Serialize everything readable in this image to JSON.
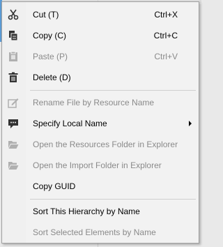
{
  "context_menu": {
    "items": [
      {
        "label": "Cut (T)",
        "shortcut": "Ctrl+X",
        "icon": "scissors-icon",
        "enabled": true
      },
      {
        "label": "Copy (C)",
        "shortcut": "Ctrl+C",
        "icon": "copy-icon",
        "enabled": true
      },
      {
        "label": "Paste (P)",
        "shortcut": "Ctrl+V",
        "icon": "paste-icon",
        "enabled": false
      },
      {
        "label": "Delete (D)",
        "shortcut": "",
        "icon": "trash-icon",
        "enabled": true
      },
      {
        "label": "Rename File by Resource Name",
        "shortcut": "",
        "icon": "rename-icon",
        "enabled": false
      },
      {
        "label": "Specify Local Name",
        "shortcut": "",
        "icon": "comment-icon",
        "enabled": true,
        "submenu": true
      },
      {
        "label": "Open the Resources Folder in Explorer",
        "shortcut": "",
        "icon": "folder-open-icon",
        "enabled": false
      },
      {
        "label": "Open the Import Folder in Explorer",
        "shortcut": "",
        "icon": "folder-open-icon",
        "enabled": false
      },
      {
        "label": "Copy GUID",
        "shortcut": "",
        "icon": "",
        "enabled": true
      },
      {
        "label": "Sort This Hierarchy by Name",
        "shortcut": "",
        "icon": "",
        "enabled": true
      },
      {
        "label": "Sort Selected Elements by Name",
        "shortcut": "",
        "icon": "",
        "enabled": false
      }
    ]
  },
  "colors": {
    "menu_bg": "#f2f2f2",
    "disabled_text": "#8a8a8a",
    "enabled_icon": "#333333",
    "disabled_icon": "#b0b0b0"
  }
}
